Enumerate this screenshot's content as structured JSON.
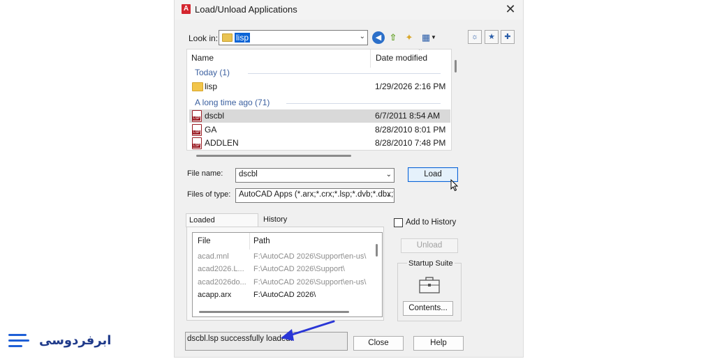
{
  "dialog": {
    "title": "Load/Unload Applications",
    "app_icon_letter": "A",
    "close_glyph": "✕"
  },
  "lookin": {
    "label": "Look in:",
    "value": "lisp"
  },
  "filelist": {
    "col_name": "Name",
    "col_date": "Date modified",
    "groups": [
      {
        "label": "Today (1)"
      },
      {
        "label": "A long time ago (71)"
      }
    ],
    "rows": [
      {
        "name": "lisp",
        "date": "1/29/2026 2:16 PM",
        "icon": "folder-icon"
      },
      {
        "name": "dscbl",
        "date": "6/7/2011 8:54 AM",
        "icon": "lsp-file-icon",
        "selected": true
      },
      {
        "name": "GA",
        "date": "8/28/2010 8:01 PM",
        "icon": "lsp-file-icon"
      },
      {
        "name": "ADDLEN",
        "date": "8/28/2010 7:48 PM",
        "icon": "lsp-file-icon"
      }
    ]
  },
  "form": {
    "file_name_label": "File name:",
    "file_name_value": "dscbl",
    "files_of_type_label": "Files of type:",
    "files_of_type_value": "AutoCAD Apps (*.arx;*.crx;*.lsp;*.dvb;*.dbx;*.",
    "load_button": "Load"
  },
  "tabs": {
    "loaded": "Loaded Applications",
    "history": "History list"
  },
  "loaded_list": {
    "col_file": "File",
    "col_path": "Path",
    "rows": [
      {
        "file": "acad.mnl",
        "path": "F:\\AutoCAD 2026\\Support\\en-us\\",
        "dim": true
      },
      {
        "file": "acad2026.L...",
        "path": "F:\\AutoCAD 2026\\Support\\",
        "dim": true
      },
      {
        "file": "acad2026do...",
        "path": "F:\\AutoCAD 2026\\Support\\en-us\\",
        "dim": true
      },
      {
        "file": "acapp.arx",
        "path": "F:\\AutoCAD 2026\\",
        "dim": false
      }
    ]
  },
  "side": {
    "add_to_history": "Add to History",
    "unload_button": "Unload",
    "startup_suite_title": "Startup Suite",
    "contents_button": "Contents..."
  },
  "status": {
    "text": "dscbl.lsp successfully loaded."
  },
  "footer": {
    "close_button": "Close",
    "help_button": "Help"
  },
  "brand": {
    "text": "ابرفردوسی"
  },
  "colors": {
    "accent_blue": "#0a64d6",
    "annotation_arrow": "#2a36d6",
    "brand_blue": "#1e5fd6"
  }
}
